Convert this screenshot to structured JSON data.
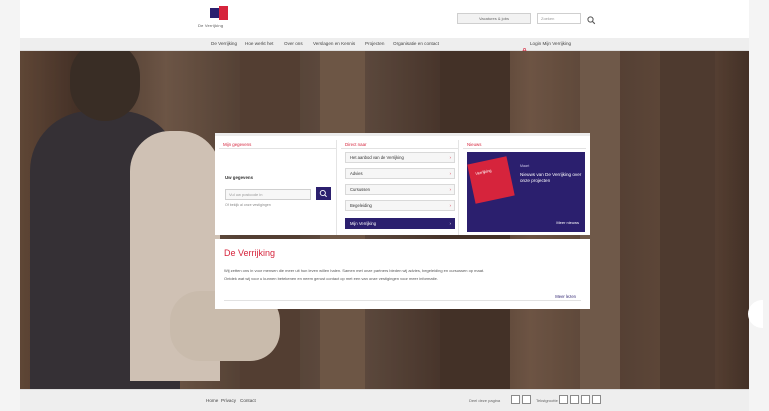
{
  "header": {
    "logo_text": "De Verrijking",
    "vacature_label": "Vacatures & jobs",
    "search_placeholder": "Zoeken"
  },
  "nav": {
    "items": [
      "De Verrijking",
      "Hoe werkt het",
      "Over ons",
      "Verslagen en Kennis",
      "Projecten",
      "Organisatie en contact"
    ],
    "login_label": "Login Mijn Verrijking"
  },
  "panel": {
    "col1_heading": "Mijn gegevens",
    "phone_label": "Uw gegevens",
    "phone_placeholder": "Vul uw postcode in",
    "phone_hint": "Of bekijk al onze vestigingen",
    "col2_heading": "Direct naar",
    "menu_items": [
      "Het aanbod van de Verrijking",
      "Advies",
      "Cursussen",
      "Begeleiding",
      "Mijn Verrijking"
    ],
    "col3_heading": "Nieuws",
    "news_image_label": "Verrijking",
    "news_date": "Maart",
    "news_title": "Nieuws van De Verrijking over onze projecten",
    "news_more": "Meer nieuws"
  },
  "intro": {
    "title": "De Verrijking",
    "lines": [
      "Wij zetten ons in voor mensen die meer uit hun leven willen halen. Samen met onze partners bieden wij advies, begeleiding en cursussen op maat.",
      "Ontdek wat wij voor u kunnen betekenen en neem gerust contact op met een van onze vestigingen voor meer informatie."
    ],
    "more_label": "Meer lezen"
  },
  "footer": {
    "links": [
      "Home",
      "Privacy",
      "Contact"
    ],
    "share_label": "Deel deze pagina",
    "size_label": "Tekstgrootte"
  },
  "colors": {
    "brand_red": "#d6243c",
    "brand_navy": "#2b1f6e"
  },
  "icons": {
    "search": "search-icon",
    "lock": "lock-icon",
    "arrow": "chevron-right-icon"
  }
}
